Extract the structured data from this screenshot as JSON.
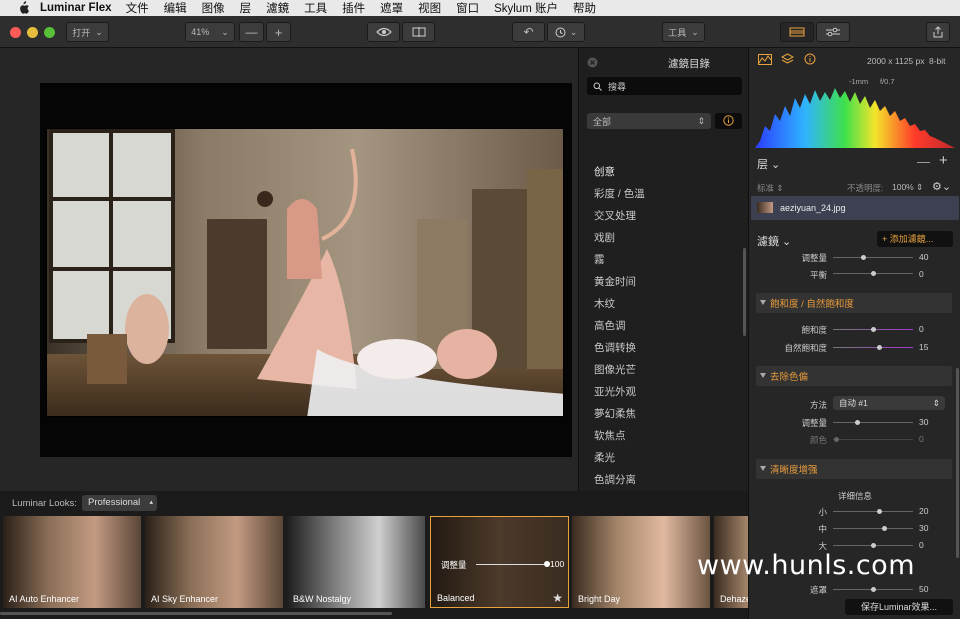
{
  "menubar": {
    "app": "Luminar Flex",
    "items": [
      "文件",
      "编辑",
      "图像",
      "层",
      "濾鏡",
      "工具",
      "插件",
      "遮罩",
      "视图",
      "窗口",
      "Skylum 账户",
      "帮助"
    ]
  },
  "toolbar": {
    "open": "打开",
    "zoom": "41%",
    "minus": "—",
    "plus": "+",
    "tools": "工具"
  },
  "filters": {
    "title": "濾鏡目錄",
    "search_placeholder": "搜尋",
    "category": "全部",
    "items": [
      "创意",
      "彩度 / 色溫",
      "交叉处理",
      "戏剧",
      "霧",
      "黄金时间",
      "木纹",
      "高色调",
      "色调转换",
      "图像光芒",
      "亚光外观",
      "夢幻柔焦",
      "软焦点",
      "柔光",
      "色調分离"
    ]
  },
  "looks": {
    "label": "Luminar Looks:",
    "category": "Professional",
    "thumbs": [
      "AI Auto Enhancer",
      "AI Sky Enhancer",
      "B&W Nostalgy",
      "Balanced",
      "Bright Day",
      "Dehaze"
    ],
    "amount_label": "调整量",
    "amount_value": "100"
  },
  "info": {
    "size": "2000 x 1125 px",
    "bits": "8-bit",
    "focal": "-1mm",
    "aperture": "f/0.7"
  },
  "layers": {
    "title": "层",
    "blend": "标准",
    "opacity_label": "不透明度:",
    "opacity": "100%",
    "file": "aeziyuan_24.jpg"
  },
  "filters_panel": {
    "title": "濾鏡",
    "add": "+ 添加濾鏡...",
    "top_rows": [
      {
        "label": "调整量",
        "value": "40"
      },
      {
        "label": "平衡",
        "value": "0"
      }
    ],
    "saturation": {
      "title": "飽和度 / 自然飽和度",
      "rows": [
        {
          "label": "飽和度",
          "value": "0"
        },
        {
          "label": "自然飽和度",
          "value": "15"
        }
      ]
    },
    "castremove": {
      "title": "去除色偏",
      "method_label": "方法",
      "method": "自动 #1",
      "rows": [
        {
          "label": "调整量",
          "value": "30"
        },
        {
          "label": "颜色",
          "value": "0"
        }
      ]
    },
    "clarity": {
      "title": "清晰度增强",
      "subtitle": "详细信息",
      "rows": [
        {
          "label": "小",
          "value": "20"
        },
        {
          "label": "中",
          "value": "30"
        },
        {
          "label": "大",
          "value": "0"
        },
        {
          "label": "遮罩",
          "value": "50"
        }
      ]
    },
    "save": "保存Luminar效果..."
  },
  "watermark": "www.hunls.com"
}
